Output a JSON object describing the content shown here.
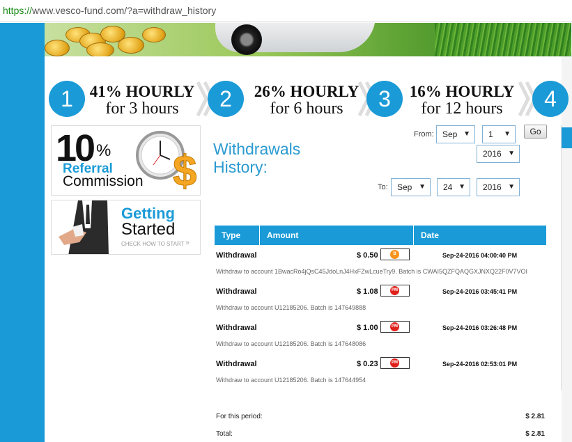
{
  "browser": {
    "url_scheme": "https://",
    "url_rest": "www.vesco-fund.com/?a=withdraw_history"
  },
  "plans": [
    {
      "num": "1",
      "rate": "41% HOURLY",
      "period": "for 3 hours"
    },
    {
      "num": "2",
      "rate": "26% HOURLY",
      "period": "for 6 hours"
    },
    {
      "num": "3",
      "rate": "16% HOURLY",
      "period": "for 12 hours"
    },
    {
      "num": "4"
    }
  ],
  "promo": {
    "referral_big": "10",
    "referral_pct": "%",
    "referral_word": "Referral",
    "referral_comm": "Commission",
    "gs_getting": "Getting",
    "gs_started": "Started",
    "gs_check": "CHECK HOW TO START"
  },
  "page": {
    "title_line1": "Withdrawals",
    "title_line2": "History:"
  },
  "filter": {
    "from_label": "From:",
    "to_label": "To:",
    "from_month": "Sep",
    "from_day": "1",
    "from_year": "2016",
    "to_month": "Sep",
    "to_day": "24",
    "to_year": "2016",
    "go_label": "Go"
  },
  "table": {
    "headers": {
      "type": "Type",
      "amount": "Amount",
      "date": "Date"
    },
    "rows": [
      {
        "type": "Withdrawal",
        "amount": "$ 0.50",
        "method": "bitcoin-icon",
        "date": "Sep-24-2016 04:00:40 PM",
        "desc": "Withdraw to account 1BwacRo4jQsC45JdoLnJ4HxFZwLcueTry9. Batch is CWAI5QZFQAQGXJNXQ22F0V7VOI"
      },
      {
        "type": "Withdrawal",
        "amount": "$ 1.08",
        "method": "perfectmoney-icon",
        "date": "Sep-24-2016 03:45:41 PM",
        "desc": "Withdraw to account U12185206. Batch is 147649888"
      },
      {
        "type": "Withdrawal",
        "amount": "$ 1.00",
        "method": "perfectmoney-icon",
        "date": "Sep-24-2016 03:26:48 PM",
        "desc": "Withdraw to account U12185206. Batch is 147648086"
      },
      {
        "type": "Withdrawal",
        "amount": "$ 0.23",
        "method": "perfectmoney-icon",
        "date": "Sep-24-2016 02:53:01 PM",
        "desc": "Withdraw to account U12185206. Batch is 147644954"
      }
    ],
    "icon_text": {
      "bitcoin": "B",
      "pm": "PM"
    }
  },
  "totals": {
    "period_label": "For this period:",
    "period_value": "$ 2.81",
    "total_label": "Total:",
    "total_value": "$ 2.81"
  },
  "colors": {
    "accent": "#1a9bd7",
    "title": "#2a9ad0",
    "bitcoin": "#f7931a",
    "perfectmoney": "#e0211b"
  }
}
